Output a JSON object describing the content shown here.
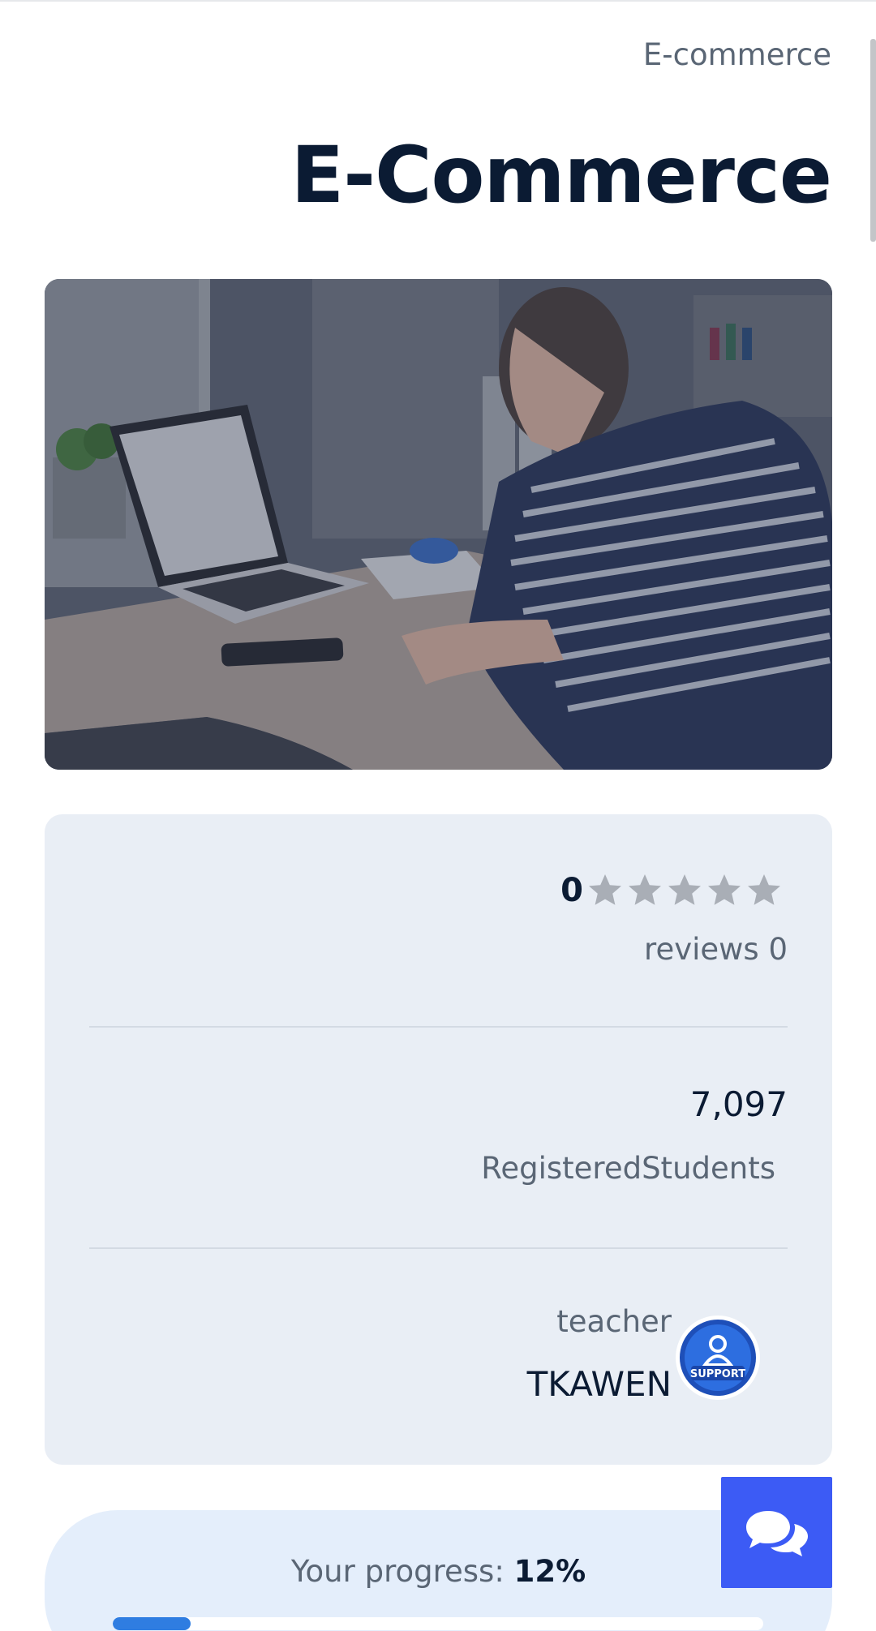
{
  "breadcrumb": "E-commerce",
  "title": "E-Commerce",
  "hero": {
    "alt": "Woman working on a laptop at a desk"
  },
  "rating": {
    "value": "0",
    "stars_total": 5,
    "stars_filled": 0,
    "reviews_label": "reviews 0"
  },
  "students": {
    "count": "7,097",
    "label": "RegisteredStudents"
  },
  "teacher": {
    "label": "teacher",
    "name": "TKAWEN",
    "avatar_text": "SUPPORT"
  },
  "progress": {
    "label": "Your progress:",
    "value_text": "12%",
    "value": 0.12
  },
  "chat_button": {
    "icon": "chat-bubbles-icon"
  },
  "colors": {
    "title": "#0b1b33",
    "muted": "#5a6675",
    "card_bg": "#e9eef5",
    "progress_bg": "#e4eefb",
    "progress_fill": "#2f7de1",
    "chat_button": "#3c5bf5",
    "star_empty": "#a9aeb6"
  }
}
